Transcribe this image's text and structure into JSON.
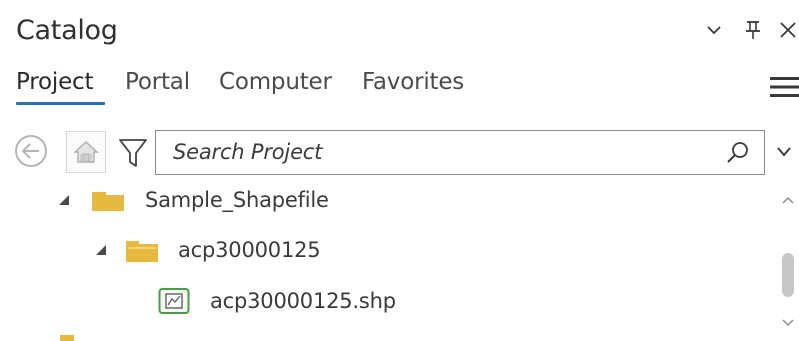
{
  "panel": {
    "title": "Catalog",
    "window_buttons": [
      "chevron-down-icon",
      "pin-icon",
      "close-icon"
    ]
  },
  "tabs": [
    {
      "label": "Project",
      "active": true
    },
    {
      "label": "Portal",
      "active": false
    },
    {
      "label": "Computer",
      "active": false
    },
    {
      "label": "Favorites",
      "active": false
    }
  ],
  "toolbar": {
    "icons": [
      "back-arrow-icon",
      "home-icon",
      "filter-icon",
      "hamburger-menu-icon"
    ]
  },
  "search": {
    "placeholder": "Search Project",
    "icons": [
      "magnifier-icon",
      "chevron-down-icon"
    ]
  },
  "tree": [
    {
      "label": "Sample_Shapefile",
      "type": "folder",
      "level": 0,
      "expanded": true
    },
    {
      "label": "acp30000125",
      "type": "folder",
      "level": 1,
      "expanded": true
    },
    {
      "label": "acp30000125.shp",
      "type": "shapefile",
      "level": 2
    }
  ],
  "colors": {
    "accent": "#1f73c9",
    "folder": "#e8b93f",
    "shapefile_icon": "#4d9a4d",
    "text": "#2b2b2b"
  }
}
